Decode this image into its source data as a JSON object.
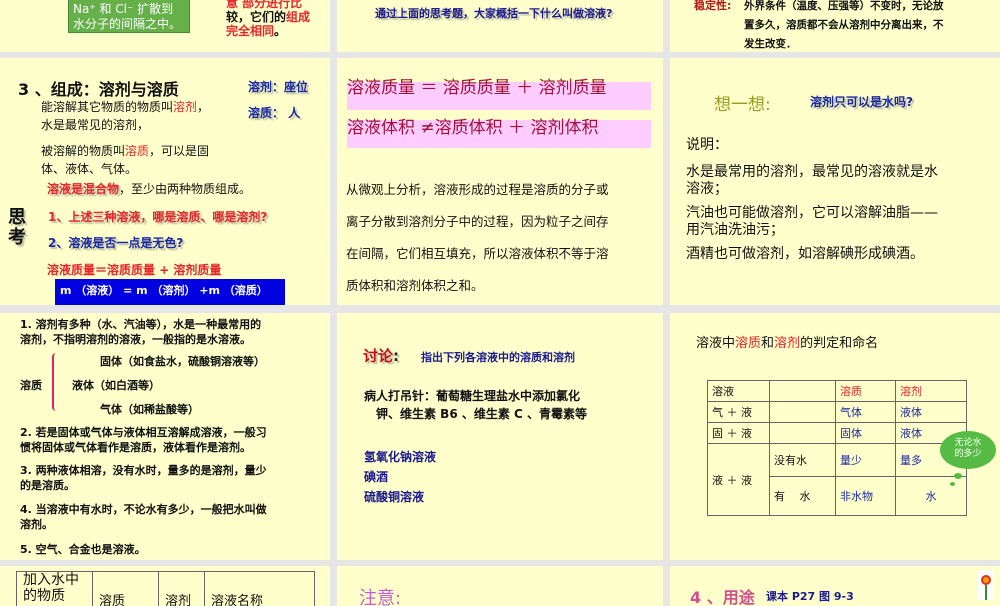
{
  "s1": {
    "box": [
      "Na⁺ 和 Cl⁻ 扩散到",
      "水分子的间隔之中。"
    ],
    "r1": "意 部分进行比",
    "r2a": "较，它们的",
    "r2b": "组成",
    "r3": "完全相同",
    "r3end": "。"
  },
  "s2": {
    "q": "通过上面的思考题，大家概括一下什么叫做溶液?"
  },
  "s3": {
    "label": "稳定性:",
    "lines": [
      "外界条件（温度、压强等）不变时，无论放",
      "置多久，溶质都不会从溶剂中分离出来，不",
      "发生改变．"
    ]
  },
  "s4": {
    "title": "3 、组成：溶剂与溶质",
    "side1": "溶剂：座位",
    "side2": "溶质：   人",
    "p1a": "能溶解其它物质的物质叫",
    "p1b": "溶剂",
    "p1c": "，",
    "p1d": "水是最常见的溶剂，",
    "p2a": "被溶解的物质叫",
    "p2b": "溶质",
    "p2c": "，可以是固",
    "p2d": "体、液体、气体。",
    "p3a": "溶液是混合物",
    "p3b": "，至少由两种物质组成。",
    "think": "思考",
    "q1": "1、上述三种溶液，哪是溶质、哪是溶剂?",
    "q2": "2、溶液是否一点是无色?",
    "formula": "溶液质量＝溶质质量 + 溶剂质量",
    "mbox": "m （溶液） = m （溶剂） +m （溶质）"
  },
  "s5": {
    "l1": "溶液质量 ＝ 溶质质量 ＋ 溶剂质量",
    "l2": "溶液体积 ≠溶质体积 ＋ 溶剂体积",
    "para": [
      "从微观上分析，溶液形成的过程是溶质的分子或",
      "离子分散到溶剂分子中的过程，因为粒子之间存",
      "在间隔，它们相互填充，所以溶液体积不等于溶",
      "质体积和溶剂体积之和。"
    ]
  },
  "s6": {
    "think": "想一想:",
    "q": "溶剂只可以是水吗?",
    "note": "说明：",
    "p": [
      "水是最常用的溶剂，最常见的溶液就是水",
      "溶液；",
      "汽油也可能做溶剂，它可以溶解油脂——",
      "用汽油洗油污；",
      "酒精也可做溶剂，如溶解碘形成碘酒。"
    ]
  },
  "s7": {
    "l1": [
      "1. 溶剂有多种（水、汽油等），水是一种最常用的",
      "溶剂，不指明溶剂的溶液，一般指的是水溶液。"
    ],
    "solute": "溶质",
    "solid": "固体（如食盐水，硫酸铜溶液等）",
    "liquid": "液体（如白酒等）",
    "gas": "气体（如稀盐酸等）",
    "l2": [
      "2. 若是固体或气体与液体相互溶解成溶液，一般习",
      "惯将固体或气体看作是溶质，液体看作是溶剂。"
    ],
    "l3": [
      "3. 两种液体相溶，没有水时，量多的是溶剂，量少",
      "的是溶质。"
    ],
    "l4": [
      "4. 当溶液中有水时，不论水有多少，一般把水叫做",
      "溶剂。"
    ],
    "l5": "5. 空气、合金也是溶液。"
  },
  "s8": {
    "title": "讨论",
    "colon": ":",
    "sub": "指出下列各溶液中的溶质和溶剂",
    "p1": "病人打吊针：葡萄糖生理盐水中添加氯化",
    "p2": "钾、维生素 B6 、维生素 C 、青霉素等",
    "items": [
      "氢氧化钠溶液",
      "碘酒",
      "硫酸铜溶液"
    ]
  },
  "s9": {
    "ta": "溶液中",
    "tb": "溶质",
    "tc": "和",
    "td": "溶剂",
    "te": "的判定和命名",
    "h": [
      "溶液",
      "",
      "溶质",
      "溶剂"
    ],
    "r1": [
      "气 ＋ 液",
      "气体",
      "液体"
    ],
    "r2": [
      "固 ＋ 液",
      "固体",
      "液体"
    ],
    "r3": [
      "液 ＋ 液",
      "没有水",
      "量少",
      "量多"
    ],
    "r4": [
      "有　 水",
      "非水物",
      "水"
    ],
    "cloud": [
      "无论水",
      "的多少"
    ]
  },
  "s10": {
    "h": [
      "加入水中的物质",
      "溶质",
      "溶剂",
      "溶液名称"
    ]
  },
  "s11": {
    "title": "注意:"
  },
  "s12": {
    "title": "4 、用途",
    "ref": "课本 P27 图 9-3"
  }
}
